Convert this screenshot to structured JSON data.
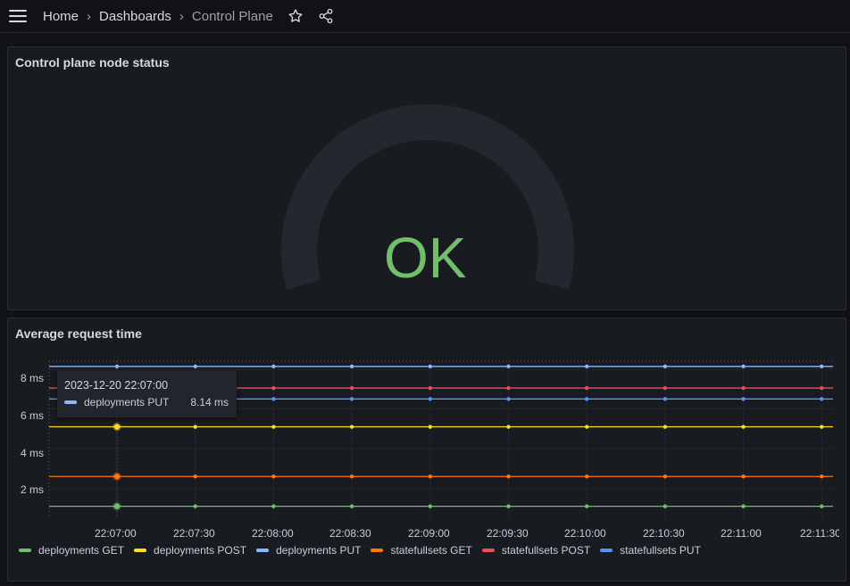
{
  "topbar": {
    "breadcrumb": [
      "Home",
      "Dashboards",
      "Control Plane"
    ]
  },
  "status_panel": {
    "title": "Control plane node status",
    "value": "OK",
    "value_color": "#73bf69"
  },
  "timeseries_panel": {
    "title": "Average request time",
    "tooltip": {
      "time": "2023-12-20 22:07:00",
      "series": "deployments PUT",
      "value": "8.14 ms"
    }
  },
  "chart_data": {
    "type": "line",
    "title": "Average request time",
    "x": [
      "22:07:00",
      "22:07:30",
      "22:08:00",
      "22:08:30",
      "22:09:00",
      "22:09:30",
      "22:10:00",
      "22:10:30",
      "22:11:00",
      "22:11:30"
    ],
    "y_ticks": [
      "2 ms",
      "4 ms",
      "6 ms",
      "8 ms"
    ],
    "ylim": [
      0.5,
      8.4
    ],
    "series": [
      {
        "name": "deployments GET",
        "color": "#73bf69",
        "value": 1.1
      },
      {
        "name": "deployments POST",
        "color": "#fade2a",
        "value": 5.1
      },
      {
        "name": "deployments PUT",
        "color": "#8ab8ff",
        "value": 8.14
      },
      {
        "name": "statefullsets GET",
        "color": "#ff780a",
        "value": 2.6
      },
      {
        "name": "statefullsets POST",
        "color": "#f2495c",
        "value": 7.05
      },
      {
        "name": "statefullsets PUT",
        "color": "#5794f2",
        "value": 6.5
      }
    ],
    "highlight_x": "22:07:00",
    "grid": true,
    "legend": "bottom"
  }
}
